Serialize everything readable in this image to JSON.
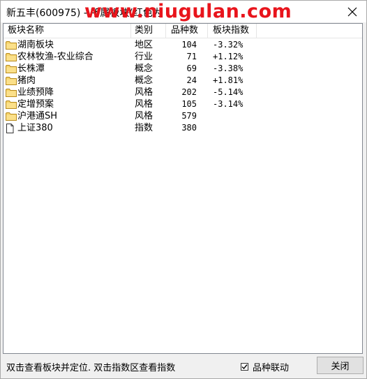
{
  "window": {
    "title": "新五丰(600975) - 所属板块(红色为",
    "watermark": "www.niugulan.com"
  },
  "table": {
    "columns": [
      "板块名称",
      "类别",
      "品种数",
      "板块指数"
    ],
    "rows": [
      {
        "icon": "folder-icon",
        "name": "湖南板块",
        "category": "地区",
        "count": "104",
        "index": "-3.32%"
      },
      {
        "icon": "folder-icon",
        "name": "农林牧渔-农业综合",
        "category": "行业",
        "count": "71",
        "index": "+1.12%"
      },
      {
        "icon": "folder-icon",
        "name": "长株潭",
        "category": "概念",
        "count": "69",
        "index": "-3.38%"
      },
      {
        "icon": "folder-icon",
        "name": "猪肉",
        "category": "概念",
        "count": "24",
        "index": "+1.81%"
      },
      {
        "icon": "folder-icon",
        "name": "业绩预降",
        "category": "风格",
        "count": "202",
        "index": "-5.14%"
      },
      {
        "icon": "folder-icon",
        "name": "定增预案",
        "category": "风格",
        "count": "105",
        "index": "-3.14%"
      },
      {
        "icon": "folder-icon",
        "name": "沪港通SH",
        "category": "风格",
        "count": "579",
        "index": ""
      },
      {
        "icon": "document-icon",
        "name": "上证380",
        "category": "指数",
        "count": "380",
        "index": ""
      }
    ]
  },
  "footer": {
    "hint": "双击查看板块并定位. 双击指数区查看指数",
    "link_label": "品种联动",
    "link_checked": true,
    "close_label": "关闭"
  }
}
